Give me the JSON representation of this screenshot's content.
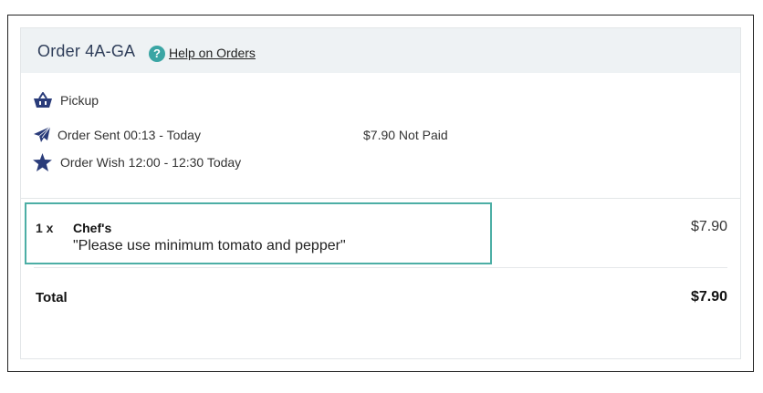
{
  "order": {
    "title": "Order 4A-GA",
    "help_icon": "question-circle-icon",
    "help_link": "Help on Orders"
  },
  "details": {
    "delivery_type_icon": "basket-icon",
    "delivery_type": "Pickup",
    "sent_icon": "paper-plane-icon",
    "sent": "Order Sent 00:13 - Today",
    "payment": "$7.90 Not Paid",
    "wish_icon": "star-icon",
    "wish": "Order Wish 12:00 - 12:30 Today"
  },
  "items": [
    {
      "qty": "1 x",
      "name": "Chef's",
      "note": "\"Please use minimum tomato and pepper\"",
      "price": "$7.90"
    }
  ],
  "total": {
    "label": "Total",
    "value": "$7.90"
  },
  "colors": {
    "header_bg": "#eef2f4",
    "icon_navy": "#2a3c7a",
    "help_teal": "#3aa5a4",
    "highlight_teal": "#4caea5"
  }
}
